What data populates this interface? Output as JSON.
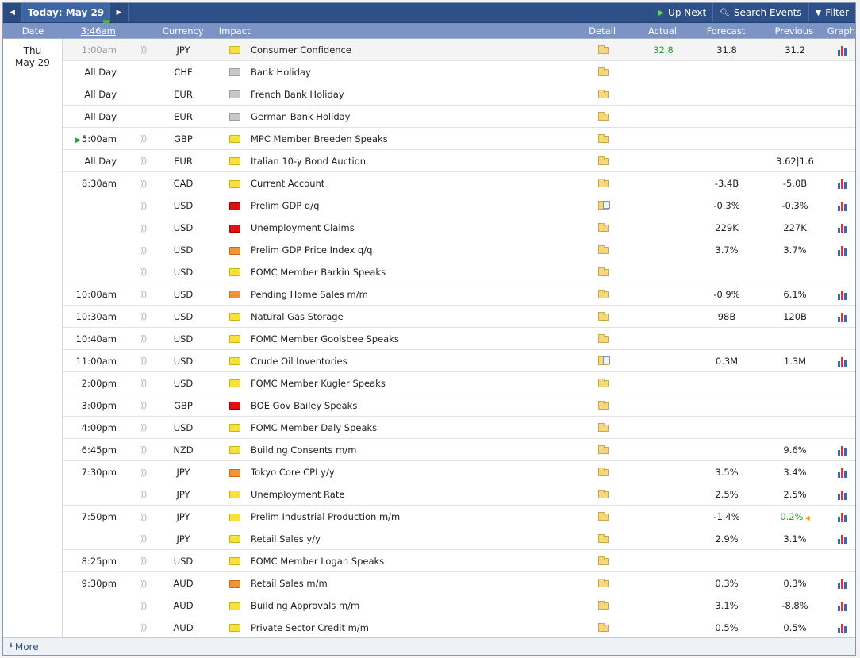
{
  "toolbar": {
    "prev_icon": "chevron-left-icon",
    "today_label": "Today: May 29",
    "next_icon": "chevron-right-icon",
    "up_next_label": "Up Next",
    "search_label": "Search Events",
    "filter_label": "Filter"
  },
  "header": {
    "date": "Date",
    "time": "3:46am",
    "currency": "Currency",
    "impact": "Impact",
    "detail": "Detail",
    "actual": "Actual",
    "forecast": "Forecast",
    "previous": "Previous",
    "graph": "Graph"
  },
  "date": {
    "day": "Thu",
    "date": "May 29"
  },
  "colors": {
    "toolbar": "#2e4f87",
    "header": "#7c93c5",
    "actual_better": "#2e9e2e"
  },
  "events": [
    {
      "time": "1:00am",
      "past": true,
      "alert": true,
      "currency": "JPY",
      "impact": "yellow",
      "event": "Consumer Confidence",
      "detail": "folder",
      "actual": "32.8",
      "actual_better": true,
      "forecast": "31.8",
      "previous": "31.2",
      "graph": true
    },
    {
      "time": "All Day",
      "alert": false,
      "currency": "CHF",
      "impact": "gray",
      "event": "Bank Holiday",
      "detail": "folder",
      "actual": "",
      "forecast": "",
      "previous": "",
      "graph": false
    },
    {
      "time": "All Day",
      "alert": false,
      "currency": "EUR",
      "impact": "gray",
      "event": "French Bank Holiday",
      "detail": "folder",
      "actual": "",
      "forecast": "",
      "previous": "",
      "graph": false
    },
    {
      "time": "All Day",
      "alert": false,
      "currency": "EUR",
      "impact": "gray",
      "event": "German Bank Holiday",
      "detail": "folder",
      "actual": "",
      "forecast": "",
      "previous": "",
      "graph": false
    },
    {
      "time": "5:00am",
      "upnext": true,
      "alert": true,
      "currency": "GBP",
      "impact": "yellow",
      "event": "MPC Member Breeden Speaks",
      "detail": "folder",
      "actual": "",
      "forecast": "",
      "previous": "",
      "graph": false
    },
    {
      "time": "All Day",
      "alert": true,
      "currency": "EUR",
      "impact": "yellow",
      "event": "Italian 10-y Bond Auction",
      "detail": "folder",
      "actual": "",
      "forecast": "",
      "previous": "3.62|1.6",
      "graph": false
    },
    {
      "time": "8:30am",
      "alert": true,
      "currency": "CAD",
      "impact": "yellow",
      "event": "Current Account",
      "detail": "folder",
      "actual": "",
      "forecast": "-3.4B",
      "previous": "-5.0B",
      "graph": true,
      "groupstart": true
    },
    {
      "time": "",
      "alert": true,
      "currency": "USD",
      "impact": "red",
      "event": "Prelim GDP q/q",
      "detail": "doc",
      "actual": "",
      "forecast": "-0.3%",
      "previous": "-0.3%",
      "graph": true
    },
    {
      "time": "",
      "alert": true,
      "currency": "USD",
      "impact": "red",
      "event": "Unemployment Claims",
      "detail": "folder",
      "actual": "",
      "forecast": "229K",
      "previous": "227K",
      "graph": true
    },
    {
      "time": "",
      "alert": true,
      "currency": "USD",
      "impact": "orange",
      "event": "Prelim GDP Price Index q/q",
      "detail": "folder",
      "actual": "",
      "forecast": "3.7%",
      "previous": "3.7%",
      "graph": true
    },
    {
      "time": "",
      "alert": true,
      "currency": "USD",
      "impact": "yellow",
      "event": "FOMC Member Barkin Speaks",
      "detail": "folder",
      "actual": "",
      "forecast": "",
      "previous": "",
      "graph": false
    },
    {
      "time": "10:00am",
      "alert": true,
      "currency": "USD",
      "impact": "orange",
      "event": "Pending Home Sales m/m",
      "detail": "folder",
      "actual": "",
      "forecast": "-0.9%",
      "previous": "6.1%",
      "graph": true
    },
    {
      "time": "10:30am",
      "alert": true,
      "currency": "USD",
      "impact": "yellow",
      "event": "Natural Gas Storage",
      "detail": "folder",
      "actual": "",
      "forecast": "98B",
      "previous": "120B",
      "graph": true
    },
    {
      "time": "10:40am",
      "alert": true,
      "currency": "USD",
      "impact": "yellow",
      "event": "FOMC Member Goolsbee Speaks",
      "detail": "folder",
      "actual": "",
      "forecast": "",
      "previous": "",
      "graph": false
    },
    {
      "time": "11:00am",
      "alert": true,
      "currency": "USD",
      "impact": "yellow",
      "event": "Crude Oil Inventories",
      "detail": "doc",
      "actual": "",
      "forecast": "0.3M",
      "previous": "1.3M",
      "graph": true
    },
    {
      "time": "2:00pm",
      "alert": true,
      "currency": "USD",
      "impact": "yellow",
      "event": "FOMC Member Kugler Speaks",
      "detail": "folder",
      "actual": "",
      "forecast": "",
      "previous": "",
      "graph": false
    },
    {
      "time": "3:00pm",
      "alert": true,
      "currency": "GBP",
      "impact": "red",
      "event": "BOE Gov Bailey Speaks",
      "detail": "folder",
      "actual": "",
      "forecast": "",
      "previous": "",
      "graph": false
    },
    {
      "time": "4:00pm",
      "alert": true,
      "currency": "USD",
      "impact": "yellow",
      "event": "FOMC Member Daly Speaks",
      "detail": "folder",
      "actual": "",
      "forecast": "",
      "previous": "",
      "graph": false
    },
    {
      "time": "6:45pm",
      "alert": true,
      "currency": "NZD",
      "impact": "yellow",
      "event": "Building Consents m/m",
      "detail": "folder",
      "actual": "",
      "forecast": "",
      "previous": "9.6%",
      "graph": true
    },
    {
      "time": "7:30pm",
      "alert": true,
      "currency": "JPY",
      "impact": "orange",
      "event": "Tokyo Core CPI y/y",
      "detail": "folder",
      "actual": "",
      "forecast": "3.5%",
      "previous": "3.4%",
      "graph": true
    },
    {
      "time": "",
      "alert": true,
      "currency": "JPY",
      "impact": "yellow",
      "event": "Unemployment Rate",
      "detail": "folder",
      "actual": "",
      "forecast": "2.5%",
      "previous": "2.5%",
      "graph": true
    },
    {
      "time": "7:50pm",
      "alert": true,
      "currency": "JPY",
      "impact": "yellow",
      "event": "Prelim Industrial Production m/m",
      "detail": "folder",
      "actual": "",
      "forecast": "-1.4%",
      "previous": "0.2%",
      "previous_revised": true,
      "graph": true
    },
    {
      "time": "",
      "alert": true,
      "currency": "JPY",
      "impact": "yellow",
      "event": "Retail Sales y/y",
      "detail": "folder",
      "actual": "",
      "forecast": "2.9%",
      "previous": "3.1%",
      "graph": true
    },
    {
      "time": "8:25pm",
      "alert": true,
      "currency": "USD",
      "impact": "yellow",
      "event": "FOMC Member Logan Speaks",
      "detail": "folder",
      "actual": "",
      "forecast": "",
      "previous": "",
      "graph": false
    },
    {
      "time": "9:30pm",
      "alert": true,
      "currency": "AUD",
      "impact": "orange",
      "event": "Retail Sales m/m",
      "detail": "folder",
      "actual": "",
      "forecast": "0.3%",
      "previous": "0.3%",
      "graph": true
    },
    {
      "time": "",
      "alert": true,
      "currency": "AUD",
      "impact": "yellow",
      "event": "Building Approvals m/m",
      "detail": "folder",
      "actual": "",
      "forecast": "3.1%",
      "previous": "-8.8%",
      "graph": true
    },
    {
      "time": "",
      "alert": true,
      "currency": "AUD",
      "impact": "yellow",
      "event": "Private Sector Credit m/m",
      "detail": "folder",
      "actual": "",
      "forecast": "0.5%",
      "previous": "0.5%",
      "graph": true
    }
  ],
  "footer": {
    "more_label": "More",
    "more_icon": "download-arrow-icon"
  }
}
